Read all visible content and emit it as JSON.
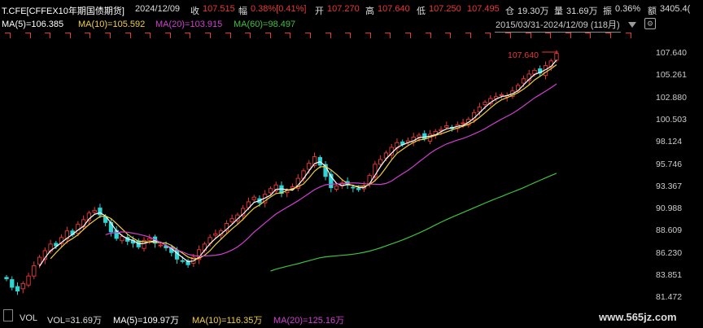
{
  "header": {
    "symbol": "T.CFE[CFFEX10年期国债期货]",
    "date": "2024/12/09",
    "close_label": "收",
    "close_value": "107.515",
    "change_label": "幅",
    "change_value": "0.38%[0.41%]",
    "open_label": "开",
    "open_value": "107.270",
    "high_label": "高",
    "high_value": "107.640",
    "low_label": "低",
    "low_value": "107.250",
    "last_value": "107.495",
    "position_label": "仓",
    "position_value": "19.30万",
    "volume_label": "量",
    "volume_value": "31.69万",
    "amplitude_label": "振",
    "amplitude_value": "0.36%",
    "amount_label": "额",
    "amount_value": "3405.4("
  },
  "ma_legend": {
    "ma5": "MA(5)=106.385",
    "ma10": "MA(10)=105.592",
    "ma20": "MA(20)=103.915",
    "ma60": "MA(60)=98.497"
  },
  "range_label": "2015/03/31-2024/12/09 (118月)",
  "price_axis": [
    "107.640",
    "105.261",
    "102.880",
    "100.503",
    "98.124",
    "95.746",
    "93.367",
    "90.988",
    "88.609",
    "86.230",
    "83.851",
    "81.472"
  ],
  "peak_label": "107.640",
  "volume_bar": {
    "vol": "VOL",
    "vol_value": "VOL=31.69万",
    "ma5": "MA(5)=109.97万",
    "ma10": "MA(10)=116.35万",
    "ma20": "MA(20)=125.16万"
  },
  "watermark": "www.565jz.com",
  "colors": {
    "up": "#e83a3a",
    "down": "#2fd4d4",
    "ma5": "#ffffff",
    "ma10": "#f0d040",
    "ma20": "#d040d0",
    "ma60": "#40c040"
  },
  "chart_data": {
    "type": "line",
    "ylim": [
      81.472,
      107.64
    ],
    "closes": [
      83.5,
      82.6,
      82.2,
      83.0,
      83.8,
      84.9,
      85.8,
      86.5,
      87.2,
      87.0,
      87.9,
      88.6,
      88.2,
      89.3,
      89.8,
      90.5,
      90.8,
      90.3,
      89.5,
      88.5,
      87.8,
      88.0,
      87.5,
      87.3,
      86.9,
      87.6,
      87.8,
      87.3,
      87.1,
      86.8,
      86.3,
      85.6,
      85.4,
      85.0,
      85.8,
      86.6,
      87.2,
      87.9,
      88.3,
      88.6,
      89.4,
      89.9,
      90.3,
      91.0,
      91.7,
      92.2,
      91.6,
      92.5,
      93.1,
      93.5,
      92.6,
      92.9,
      93.3,
      94.2,
      95.0,
      95.8,
      96.5,
      95.6,
      94.4,
      93.2,
      93.4,
      93.7,
      93.5,
      93.2,
      93.0,
      93.4,
      94.5,
      95.7,
      96.2,
      96.9,
      97.5,
      98.0,
      97.8,
      98.2,
      98.6,
      98.8,
      98.4,
      98.9,
      99.2,
      99.4,
      99.8,
      99.5,
      99.9,
      100.1,
      100.5,
      101.2,
      101.8,
      102.3,
      102.7,
      102.9,
      103.1,
      103.0,
      103.5,
      104.1,
      104.8,
      105.3,
      105.7,
      105.4,
      106.2,
      106.7,
      107.5
    ],
    "ma5_end": 106.385,
    "ma10_end": 105.592,
    "ma20_end": 103.915,
    "ma60_end": 98.497
  }
}
